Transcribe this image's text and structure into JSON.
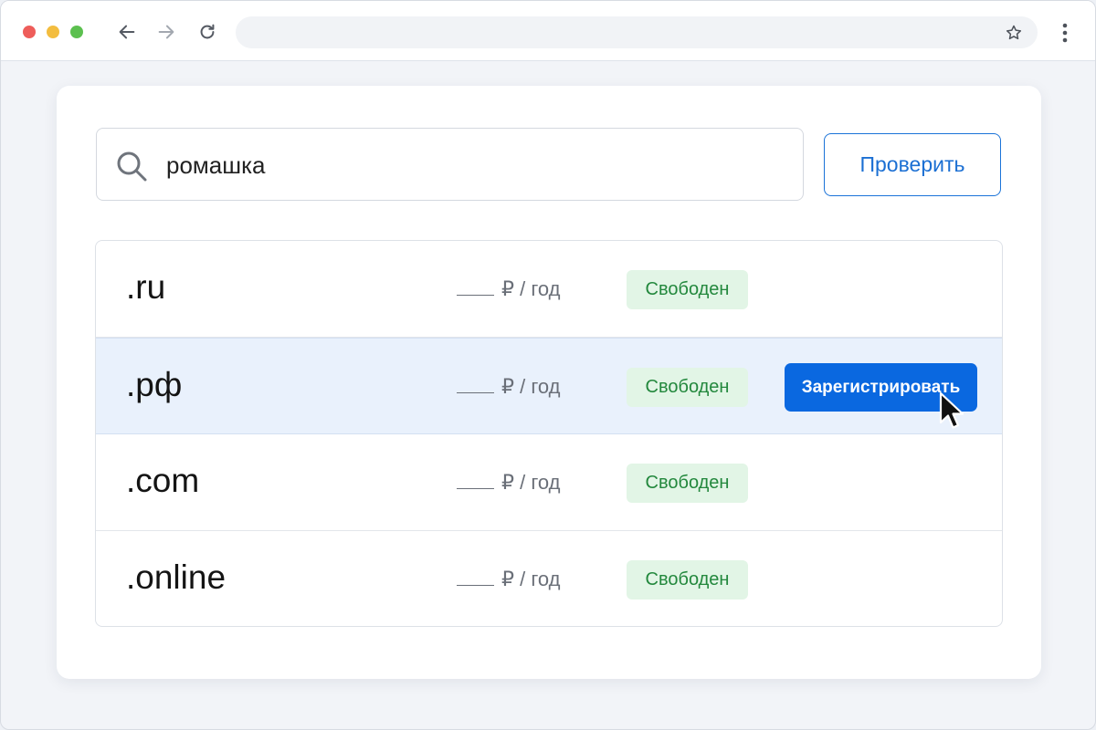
{
  "browser": {
    "address_value": ""
  },
  "search": {
    "value": "ромашка",
    "check_label": "Проверить"
  },
  "results": [
    {
      "tld": ".ru",
      "price": "₽ / год",
      "status": "Свободен"
    },
    {
      "tld": ".рф",
      "price": "₽ / год",
      "status": "Свободен",
      "action": "Зарегистрировать"
    },
    {
      "tld": ".com",
      "price": "₽ / год",
      "status": "Свободен"
    },
    {
      "tld": ".online",
      "price": "₽ / год",
      "status": "Свободен"
    }
  ],
  "icons": {
    "back": "arrow-left-icon",
    "forward": "arrow-right-icon",
    "reload": "reload-icon",
    "bookmark": "star-icon",
    "menu": "kebab-menu-icon",
    "search": "search-icon",
    "cursor": "mouse-cursor-icon"
  },
  "colors": {
    "accent": "#0a68e0",
    "status_free_bg": "#e2f5e6",
    "status_free_text": "#23883d",
    "highlight_row": "#e9f1fc"
  }
}
